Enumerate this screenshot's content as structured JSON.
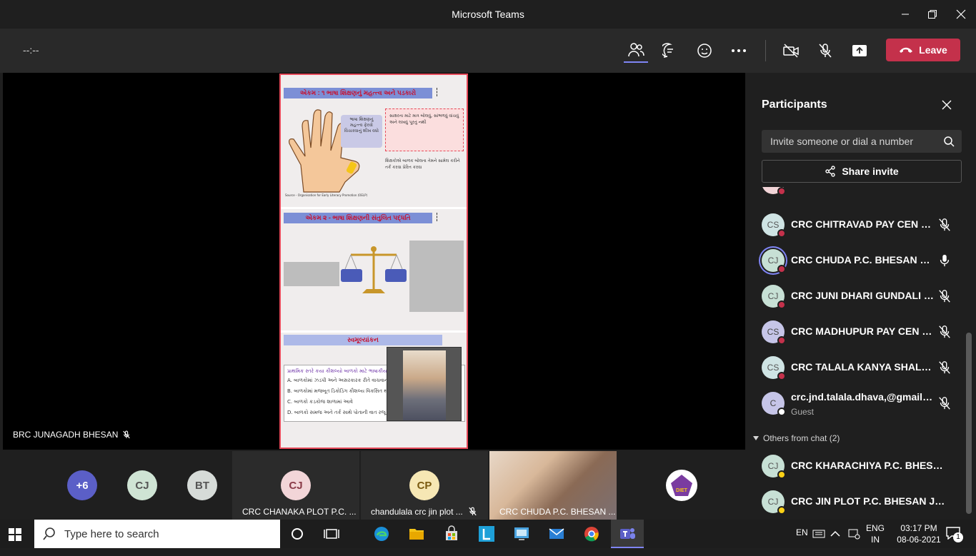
{
  "window": {
    "title": "Microsoft Teams"
  },
  "toolbar": {
    "timer": "--:--",
    "leave_label": "Leave"
  },
  "stage": {
    "presenter_name": "BRC JUNAGADH BHESAN",
    "slide": {
      "section1_title": "એકમ : ૧ ભાષા શિક્ષણનું મહત્ત્વ અને પડકારો",
      "section1_bubble": "ભાષા શિક્ષણનું મહત્ત્વ ફેરવો વિચારવાનું શીખ વધો",
      "section1_quote": "સાક્ષરતા માટે માત્ર બોલવું, સાંભળવું વાંચવું અને લખવું પૂરતું નથી",
      "section1_body": "શિક્ષકોએ બાળક બોલતા તેમને સામેલ કરીને તર્ક કરવા પ્રેરિત કરવા",
      "section1_source": "Source - Organisation for Early Literacy Promotion (OELP)",
      "section2_title": "એકમ ૨ - ભાષા શિક્ષણની સંતુલિત પદ્ધતિ",
      "section3_title": "સ્વમૂલ્યાંકન",
      "quiz_question": "પ્રાથમિક સ્તરે કયા કૌશલ્યો બાળકો માટે ભાષાકીય કૌશ",
      "quiz_options": [
        "A. બાળકોમાં ઝડપી અને અસરકારક રીતે વાચવાની ટેવ વિ",
        "B. બાળકોમાં મજબૂત ડિકોડિંગ કૌશલ્ય વિકસિત થાય",
        "C. બાળકો કડકોજ શાળામાં આવે",
        "D. બાળકો સમજ અને તર્ક સાથે પોતાની વાત રજૂ કરે"
      ]
    }
  },
  "panel": {
    "title": "Participants",
    "invite_placeholder": "Invite someone or dial a number",
    "share_label": "Share invite",
    "participants": [
      {
        "initials": "CS",
        "name": "CRC CHITRAVAD PAY CEN SH...",
        "status": "#c4314b"
      },
      {
        "initials": "CJ",
        "name": "CRC CHUDA P.C. BHESAN JU...",
        "status": "#c4314b"
      },
      {
        "initials": "CJ",
        "name": "CRC JUNI DHARI GUNDALI P...",
        "status": "#c4314b"
      },
      {
        "initials": "CS",
        "name": "CRC MADHUPUR PAY CEN SH...",
        "status": "#c4314b"
      },
      {
        "initials": "CS",
        "name": "CRC TALALA KANYA SHALA T...",
        "status": "#c4314b"
      },
      {
        "initials": "C",
        "name": "crc.jnd.talala.dhava,@gmail.c...",
        "sub": "Guest",
        "status": "#ffffff"
      }
    ],
    "group_label": "Others from chat (2)",
    "others": [
      {
        "initials": "CJ",
        "name": "CRC KHARACHIYA P.C. BHESAN J...",
        "status": "#fcd116"
      },
      {
        "initials": "CJ",
        "name": "CRC JIN PLOT P.C. BHESAN JUNA...",
        "status": "#fcd116"
      }
    ]
  },
  "gallery": {
    "overflow": "+6",
    "avatars": [
      "CJ",
      "BT"
    ],
    "tiles": [
      {
        "initials": "CJ",
        "name": "CRC CHANAKA PLOT P.C. ..."
      },
      {
        "initials": "CP",
        "name": "chandulala crc jin plot ..."
      },
      {
        "name": "CRC CHUDA P.C. BHESAN ..."
      }
    ],
    "logo_text": "DIET"
  },
  "taskbar": {
    "search_placeholder": "Type here to search",
    "lang1": "EN",
    "lang2": "ENG",
    "lang3": "IN",
    "time": "03:17 PM",
    "date": "08-06-2021",
    "notif_count": "1"
  }
}
